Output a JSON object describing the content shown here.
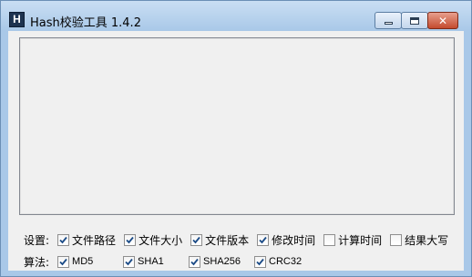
{
  "window": {
    "title": "Hash校验工具 1.4.2",
    "app_icon_letter": "H",
    "icon_min": "minimize-icon",
    "icon_max": "maximize-icon",
    "icon_close": "close-icon",
    "close_glyph": "✕"
  },
  "settings": {
    "label": "设置:",
    "options": [
      {
        "label": "文件路径",
        "checked": true
      },
      {
        "label": "文件大小",
        "checked": true
      },
      {
        "label": "文件版本",
        "checked": true
      },
      {
        "label": "修改时间",
        "checked": true
      },
      {
        "label": "计算时间",
        "checked": false
      },
      {
        "label": "结果大写",
        "checked": false
      }
    ]
  },
  "algorithms": {
    "label": "算法:",
    "options": [
      {
        "label": "MD5",
        "checked": true
      },
      {
        "label": "SHA1",
        "checked": true
      },
      {
        "label": "SHA256",
        "checked": true
      },
      {
        "label": "CRC32",
        "checked": true
      }
    ]
  },
  "colors": {
    "titlebar": "#a9c8e8",
    "client_bg": "#f0f0f0",
    "close_button": "#c44b2e",
    "check": "#1a4a86"
  }
}
